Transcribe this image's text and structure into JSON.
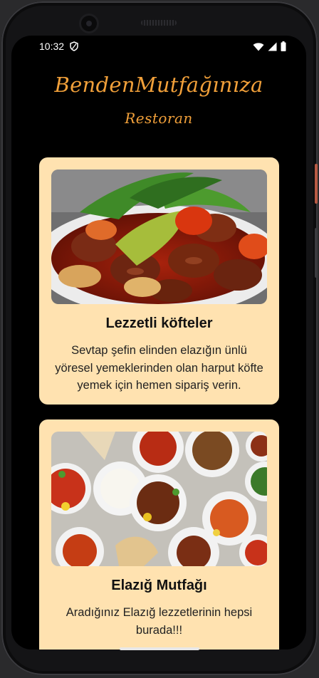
{
  "status": {
    "time": "10:32",
    "icons": [
      "vpn-shield-icon",
      "wifi-icon",
      "cellular-signal-icon",
      "battery-icon"
    ]
  },
  "app": {
    "title": "BendenMutfağınıza",
    "subtitle": "Restoran",
    "accent_color": "#f1a03a",
    "card_color": "#ffe2b0"
  },
  "cards": [
    {
      "image": "meatball-dish-photo",
      "title": "Lezzetli köfteler",
      "description": "Sevtap şefin elinden elazığın ünlü yöresel yemeklerinden olan harput köfte yemek için hemen sipariş verin."
    },
    {
      "image": "elazig-food-spread-photo",
      "title": "Elazığ Mutfağı",
      "description": "Aradığınız Elazığ lezzetlerinin hepsi burada!!!"
    }
  ]
}
